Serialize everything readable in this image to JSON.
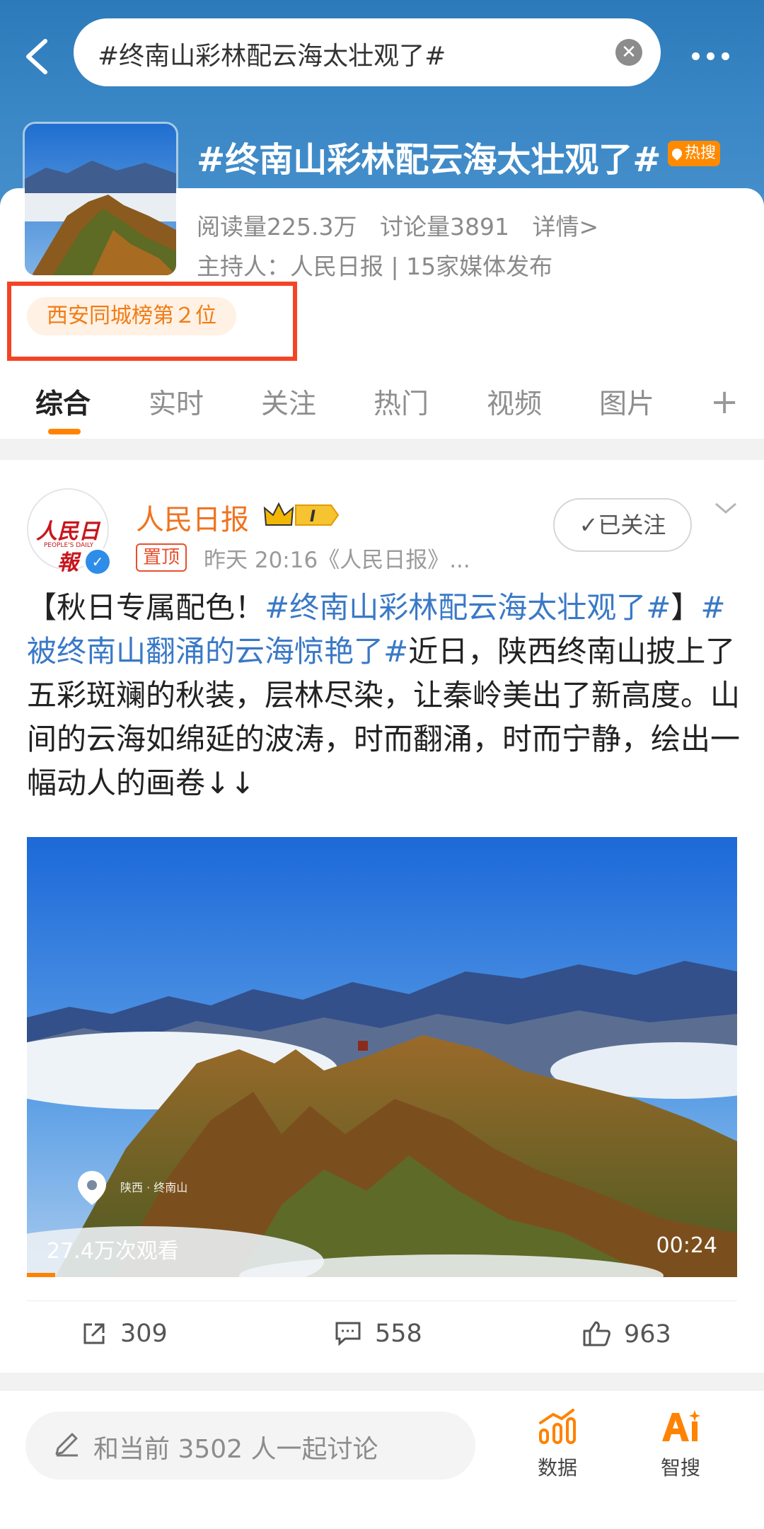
{
  "search": {
    "query": "#终南山彩林配云海太壮观了#"
  },
  "topic": {
    "title": "#终南山彩林配云海太壮观了#",
    "hot_badge": "热搜",
    "reads": "阅读量225.3万",
    "discussions": "讨论量3891",
    "details": "详情>",
    "host": "主持人：人民日报 | 15家媒体发布",
    "rank": "西安同城榜第２位"
  },
  "tabs": [
    "综合",
    "实时",
    "关注",
    "热门",
    "视频",
    "图片"
  ],
  "post": {
    "avatar_logo": "人民日報",
    "avatar_sub": "PEOPLE'S DAILY",
    "author": "人民日报",
    "level": "I",
    "pinned": "置顶",
    "meta": "昨天 20:16《人民日报》...",
    "follow_label": "已关注",
    "text_prefix": "【秋日专属配色！",
    "tag1": "#终南山彩林配云海太壮观了#",
    "text_mid": "】",
    "tag2": "#被终南山翻涌的云海惊艳了#",
    "text_body": "近日，陕西终南山披上了五彩斑斓的秋装，层林尽染，让秦岭美出了新高度。山间的云海如绵延的波涛，时而翻涌，时而宁静，绘出一幅动人的画卷↓↓",
    "video": {
      "views": "27.4万次观看",
      "duration": "00:24",
      "location": "陕西 · 终南山"
    },
    "reposts": "309",
    "comments": "558",
    "likes": "963"
  },
  "bottom": {
    "discuss_placeholder": "和当前 3502 人一起讨论",
    "data_label": "数据",
    "ai_label": "智搜"
  },
  "colors": {
    "accent": "#ff8200",
    "link": "#3a79c6",
    "header": "#3a87c6"
  }
}
